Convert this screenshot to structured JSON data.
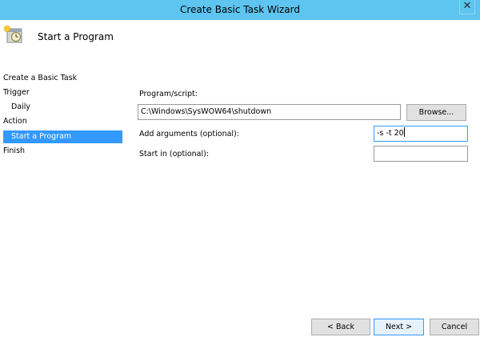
{
  "window": {
    "title": "Create Basic Task Wizard",
    "close_glyph": "✕",
    "accent_color": "#5ec4f0"
  },
  "header": {
    "icon": "task-scheduler-clock-icon",
    "title": "Start a Program"
  },
  "nav": {
    "items": [
      {
        "label": "Create a Basic Task"
      },
      {
        "label": "Trigger"
      },
      {
        "label": "Daily"
      },
      {
        "label": "Action"
      },
      {
        "label": "Start a Program"
      },
      {
        "label": "Finish"
      }
    ],
    "selected_color": "#3399ff"
  },
  "form": {
    "program_label": "Program/script:",
    "program_value": "C:\\Windows\\SysWOW64\\shutdown",
    "browse_label": "Browse...",
    "arguments_label": "Add arguments (optional):",
    "arguments_value": "-s -t 20",
    "start_in_label": "Start in (optional):",
    "start_in_value": ""
  },
  "footer": {
    "back_label": "< Back",
    "next_label": "Next >",
    "cancel_label": "Cancel"
  }
}
